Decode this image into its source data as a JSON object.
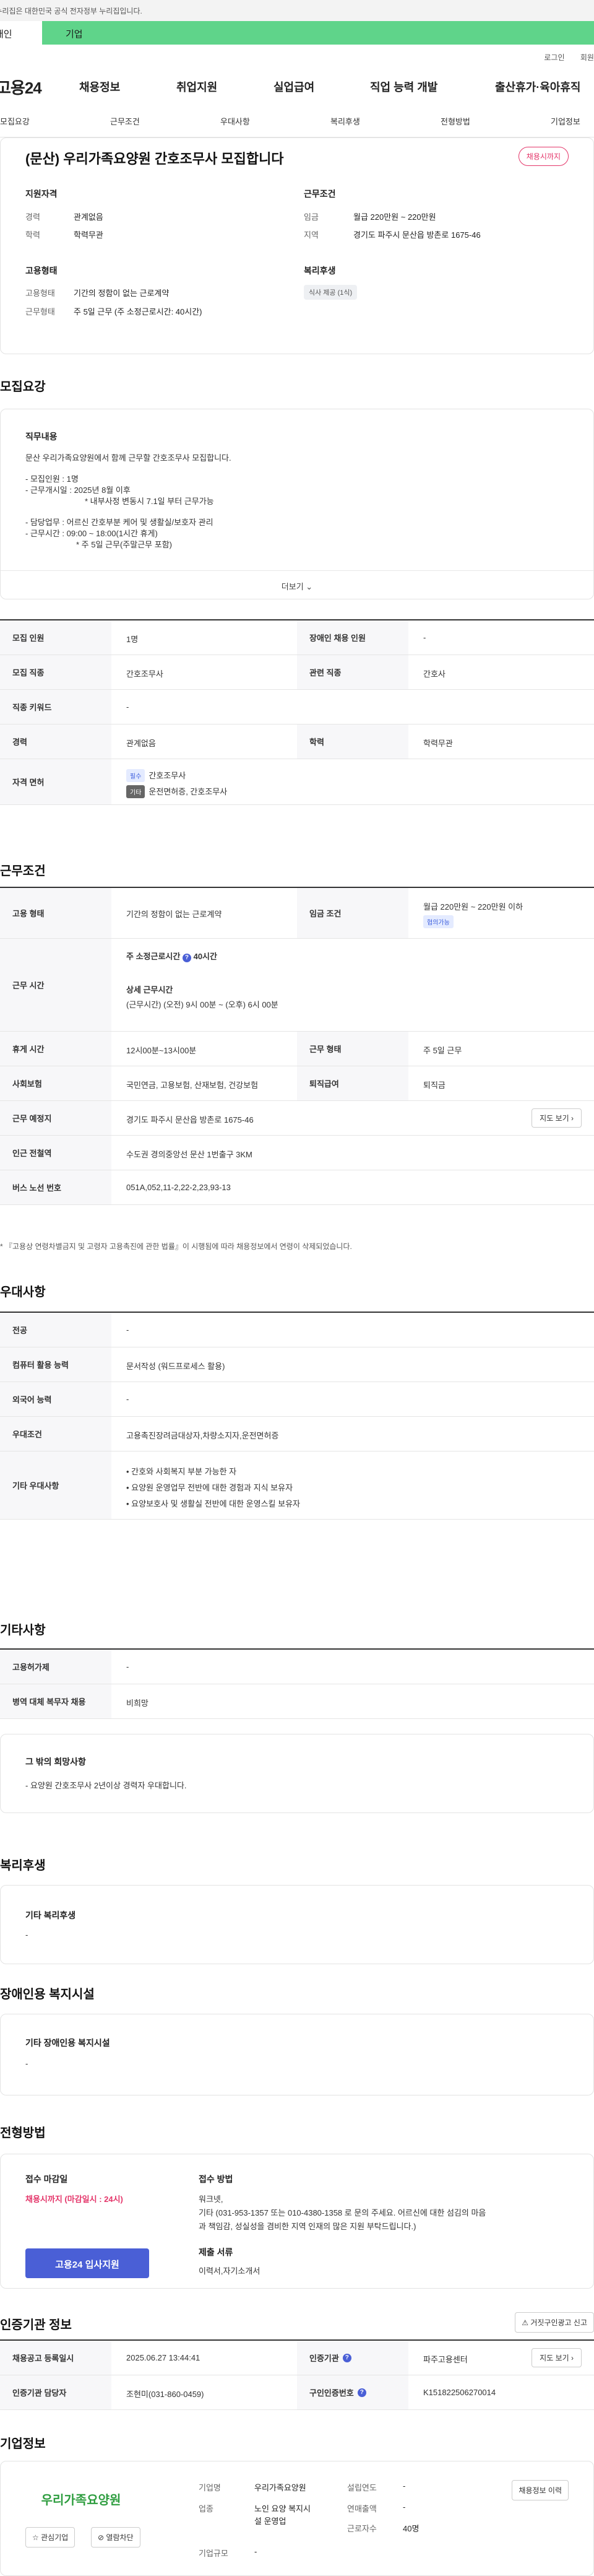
{
  "banner": {
    "text": "이 누리집은 대한민국 공식 전자정부 누리집입니다."
  },
  "tabs": {
    "personal": "개인",
    "company": "기업"
  },
  "util": {
    "login": "로그인",
    "signup": "회원가입"
  },
  "gnb": {
    "logo": "고용24",
    "menu": [
      "채용정보",
      "취업지원",
      "실업급여",
      "직업 능력 개발",
      "출산휴가·육아휴직"
    ]
  },
  "subnav": [
    "모집요강",
    "근무조건",
    "우대사항",
    "복리후생",
    "전형방법",
    "기업정보"
  ],
  "header": {
    "title": "(문산) 우리가족요양원 간호조무사 모집합니다",
    "badge": "채용시까지",
    "qual": {
      "title": "지원자격",
      "career_k": "경력",
      "career_v": "관계없음",
      "edu_k": "학력",
      "edu_v": "학력무관"
    },
    "work": {
      "title": "근무조건",
      "wage_k": "임금",
      "wage_v": "월급 220만원 ~ 220만원",
      "loc_k": "지역",
      "loc_v": "경기도 파주시 문산읍 방촌로 1675-46"
    },
    "emp": {
      "title": "고용형태",
      "type_k": "고용형태",
      "type_v": "기간의 정함이 없는 근로계약",
      "shape_k": "근무형태",
      "shape_v": "주 5일 근무 (주 소정근로시간: 40시간)"
    },
    "welfare": {
      "title": "복리후생",
      "pill": "식사 제공 (1식)"
    }
  },
  "recruit": {
    "section_title": "모집요강",
    "card_title": "직무내용",
    "lines": [
      "문산 우리가족요양원에서 함께 근무할 간호조무사 모집합니다.",
      "- 모집인원 : 1명",
      "- 근무개시일 : 2025년 8월 이후",
      "* 내부사정 변동시 7.1일 부터 근무가능",
      "- 담당업무 : 어르신 간호부분 케어 및 생활실/보호자 관리",
      "- 근무시간 : 09:00 ~ 18:00(1시간 휴게)",
      "* 주 5일 근무(주말근무 포함)"
    ],
    "more": "더보기",
    "table": {
      "count_k": "모집 인원",
      "count_v": "1명",
      "dis_k": "장애인 채용 인원",
      "dis_v": "-",
      "job_k": "모집 직종",
      "job_v": "간호조무사",
      "rel_k": "관련 직종",
      "rel_v": "간호사",
      "kw_k": "직종 키워드",
      "kw_v": "-",
      "career_k": "경력",
      "career_v": "관계없음",
      "edu_k": "학력",
      "edu_v": "학력무관",
      "license_k": "자격 면허",
      "license_req_badge": "필수",
      "license_req": "간호조무사",
      "license_etc_badge": "기타",
      "license_etc": "운전면허증, 간호조무사"
    }
  },
  "cond": {
    "section_title": "근무조건",
    "emp_k": "고용 형태",
    "emp_v": "기간의 정함이 없는 근로계약",
    "wage_k": "임금 조건",
    "wage_v": "월급 220만원 ~ 220만원 이하",
    "wage_badge": "협의가능",
    "hours_k": "근무 시간",
    "hours_main": "주 소정근로시간",
    "hours_num": "40시간",
    "hours_detail_t": "상세 근무시간",
    "hours_detail": "(근무시간) (오전) 9시 00분 ~ (오후) 6시 00분",
    "rest_k": "휴게 시간",
    "rest_v": "12시00분~13시00분",
    "shape_k": "근무 형태",
    "shape_v": "주 5일 근무",
    "ins_k": "사회보험",
    "ins_v": "국민연금, 고용보험, 산재보험, 건강보험",
    "ret_k": "퇴직급여",
    "ret_v": "퇴직금",
    "loc_k": "근무 예정지",
    "loc_v": "경기도 파주시 문산읍 방촌로 1675-46",
    "map_btn": "지도 보기",
    "sub_k": "인근 전철역",
    "sub_v": "수도권 경의중앙선 문산 1번출구 3KM",
    "bus_k": "버스 노선 번호",
    "bus_v": "051A,052,11-2,22-2,23,93-13",
    "notice": "* 『고용상 연령차별금지 및 고령자 고용촉진에 관한 법률』이 시행됨에 따라 채용정보에서 연령이 삭제되었습니다."
  },
  "pref": {
    "section_title": "우대사항",
    "major_k": "전공",
    "major_v": "-",
    "pc_k": "컴퓨터 활용 능력",
    "pc_v": "문서작성 (워드프로세스 활용)",
    "lang_k": "외국어 능력",
    "lang_v": "-",
    "cond_k": "우대조건",
    "cond_v": "고용촉진장려금대상자,차량소지자,운전면허증",
    "etc_k": "기타 우대사항",
    "etc_v": [
      "간호와 사회복지 부분 가능한 자",
      "요양원 운영업무 전반에 대한 경험과 지식 보유자",
      "요양보호사 및 생활실 전반에 대한 운영스킬 보유자"
    ]
  },
  "other": {
    "section_title": "기타사항",
    "empl_k": "고용허가제",
    "empl_v": "-",
    "mil_k": "병역 대체 복무자 채용",
    "mil_v": "비희망",
    "card_title": "그 밖의 희망사항",
    "card_v": "- 요양원 간호조무사 2년이상 경력자 우대합니다."
  },
  "welfare": {
    "section_title": "복리후생",
    "card_title": "기타 복리후생",
    "card_v": "-"
  },
  "disab": {
    "section_title": "장애인용 복지시설",
    "card_title": "기타 장애인용 복지시설",
    "card_v": "-"
  },
  "selection": {
    "section_title": "전형방법",
    "deadline_t": "접수 마감일",
    "deadline_v": "채용시까지 (마감일시 : 24시)",
    "apply_btn": "고용24 입사지원",
    "method_t": "접수 방법",
    "method_lines": [
      "워크넷,",
      "기타 (031-953-1357  또는 010-4380-1358 로 문의 주세요. 어르신에 대한 섬김의 마음",
      "과 책임감, 성실성을 겸비한 지역 인재의 많은 지원 부탁드립니다.)"
    ],
    "docs_t": "제출 서류",
    "docs_v": "이력서,자기소개서"
  },
  "cert": {
    "section_title": "인증기관 정보",
    "report_btn": "거짓구인광고 신고",
    "reg_k": "채용공고 등록일시",
    "reg_v": "2025.06.27 13:44:41",
    "org_k": "인증기관",
    "org_v": "파주고용센터",
    "map_btn": "지도 보기",
    "mgr_k": "인증기관 담당자",
    "mgr_v": "조현미(031-860-0459)",
    "num_k": "구인인증번호",
    "num_v": "K151822506270014"
  },
  "company": {
    "section_title": "기업정보",
    "logo_text": "우리가족요양원",
    "fav_btn": "관심기업",
    "block_btn": "열람차단",
    "name_k": "기업명",
    "name_v": "우리가족요양원",
    "year_k": "설립연도",
    "year_v": "-",
    "ind_k": "업종",
    "ind_v1": "노인 요양 복지시",
    "ind_v2": "설 운영업",
    "sales_k": "연매출액",
    "sales_v": "-",
    "emp_k": "근로자수",
    "emp_v": "40명",
    "size_k": "기업규모",
    "size_v": "-",
    "jobs_btn": "채용정보 이력"
  }
}
